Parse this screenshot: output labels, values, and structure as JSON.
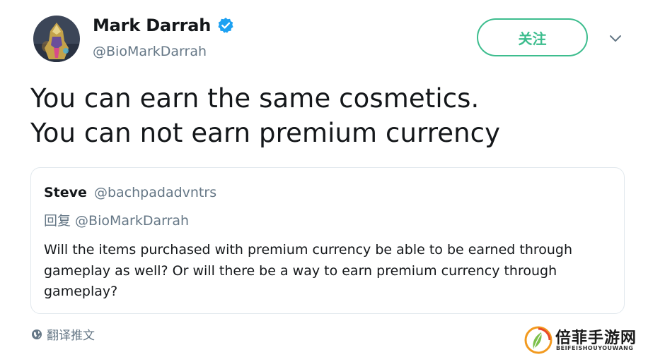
{
  "user": {
    "display_name": "Mark Darrah",
    "handle": "@BioMarkDarrah",
    "avatar_icon": "avatar-image",
    "verified_icon": "verified-badge-icon"
  },
  "follow_button": {
    "label": "关注"
  },
  "tweet": {
    "lines": [
      "You can earn the same cosmetics.",
      "You can not earn premium currency"
    ]
  },
  "quoted_tweet": {
    "name": "Steve",
    "handle": "@bachpadadvntrs",
    "reply_to": "回复 @BioMarkDarrah",
    "lines": [
      "Will the items purchased with premium currency be able to be earned through",
      "gameplay as well? Or will there be a way to earn premium currency through",
      "gameplay?"
    ]
  },
  "translate": {
    "label": "翻译推文",
    "icon": "globe-icon"
  },
  "watermark": {
    "name_cn": "倍菲手游网",
    "name_en": "BEIFEISHOUYOUWANG"
  },
  "colors": {
    "accent": "#3dbd8e",
    "verified": "#1da1f2",
    "secondary_text": "#657786",
    "border": "#e1e8ed"
  }
}
